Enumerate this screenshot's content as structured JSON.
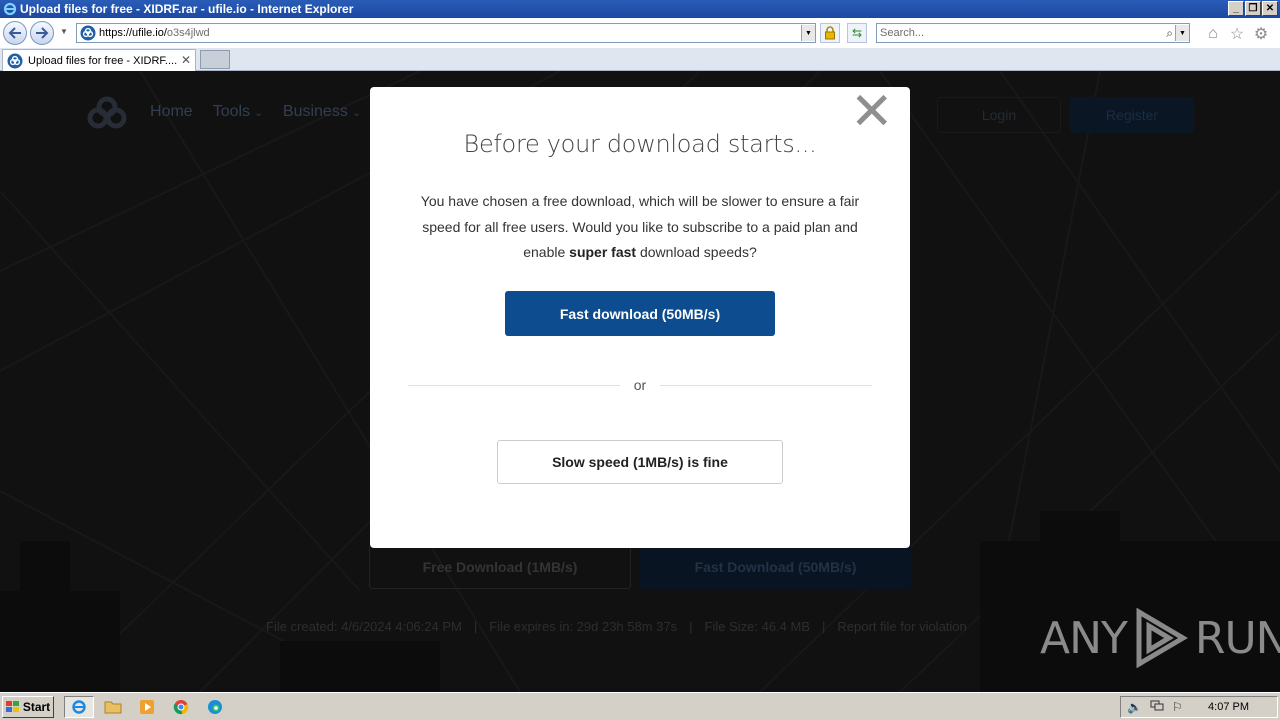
{
  "window": {
    "title": "Upload files for free - XIDRF.rar - ufile.io - Internet Explorer",
    "min_glyph": "_",
    "max_glyph": "❐",
    "close_glyph": "✕"
  },
  "address_bar": {
    "url_host": "https://ufile.io/",
    "url_path": "o3s4jlwd"
  },
  "search": {
    "placeholder": "Search..."
  },
  "tab": {
    "label": "Upload files for free - XIDRF....",
    "close_glyph": "✕"
  },
  "site": {
    "nav": {
      "home": "Home",
      "tools": "Tools",
      "business": "Business"
    },
    "login": "Login",
    "register": "Register",
    "free_download": "Free Download (1MB/s)",
    "fast_download": "Fast Download (50MB/s)",
    "file_info": {
      "created": "File created: 4/6/2024 4:06:24 PM",
      "expires": "File expires in: 29d 23h 58m 37s",
      "size": "File Size: 46.4 MB",
      "report": "Report file for violation",
      "separator": "|"
    }
  },
  "modal": {
    "close_glyph": "✕",
    "title": "Before your download starts...",
    "message_part1": "You have chosen a free download, which will be slower to ensure a fair speed for all free users. Would you like to subscribe to a paid plan and enable ",
    "message_bold": "super fast",
    "message_part2": " download speeds?",
    "fast_button": "Fast download (50MB/s)",
    "or": "or",
    "slow_button": "Slow speed (1MB/s) is fine"
  },
  "watermark": {
    "left": "ANY",
    "right": "RUN"
  },
  "taskbar": {
    "start": "Start",
    "clock": "4:07 PM"
  },
  "colors": {
    "modal_primary": "#0d4c8e",
    "titlebar": "#2a5db8"
  }
}
